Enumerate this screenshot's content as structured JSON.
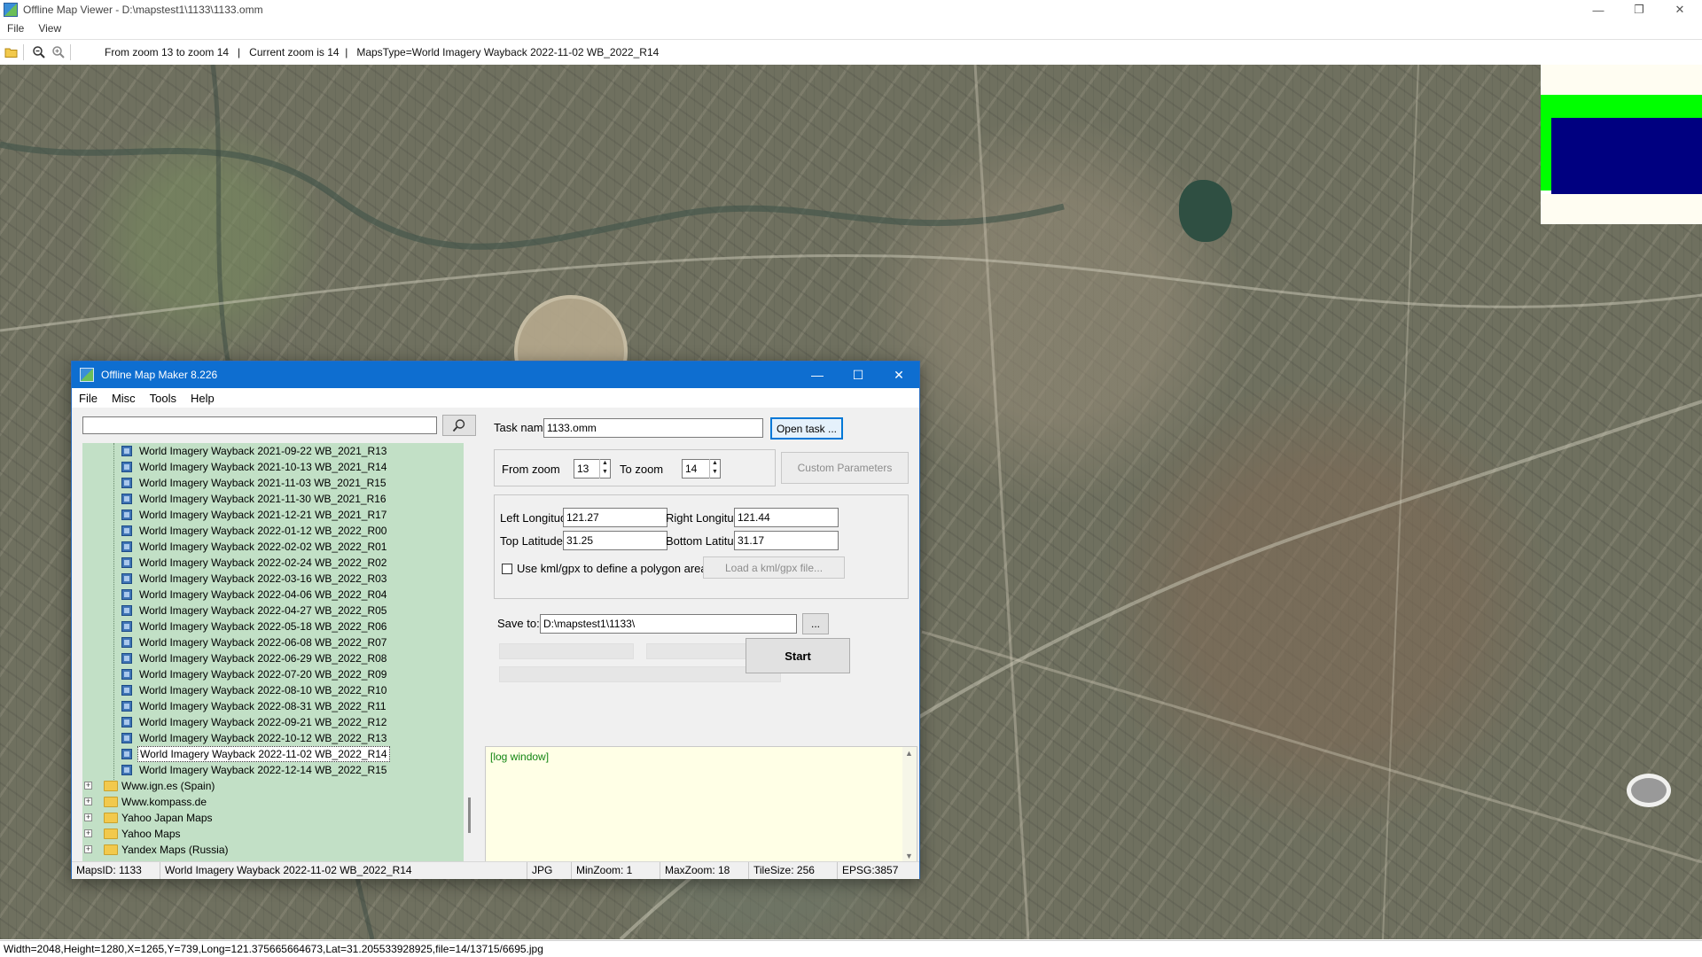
{
  "window": {
    "title": "Offline Map Viewer - D:\\mapstest1\\1133\\1133.omm",
    "menu": [
      "File",
      "View"
    ]
  },
  "toolbar": {
    "info": "From zoom 13 to zoom 14   |   Current zoom is 14  |   MapsType=World Imagery Wayback 2022-11-02 WB_2022_R14"
  },
  "status_bar": "Width=2048,Height=1280,X=1265,Y=739,Long=121.375665664673,Lat=31.205533928925,file=14/13715/6695.jpg",
  "dialog": {
    "title": "Offline Map Maker 8.226",
    "menu": [
      "File",
      "Misc",
      "Tools",
      "Help"
    ],
    "search_value": "",
    "tree_items": [
      "World Imagery Wayback 2021-09-22 WB_2021_R13",
      "World Imagery Wayback 2021-10-13 WB_2021_R14",
      "World Imagery Wayback 2021-11-03 WB_2021_R15",
      "World Imagery Wayback 2021-11-30 WB_2021_R16",
      "World Imagery Wayback 2021-12-21 WB_2021_R17",
      "World Imagery Wayback 2022-01-12 WB_2022_R00",
      "World Imagery Wayback 2022-02-02 WB_2022_R01",
      "World Imagery Wayback 2022-02-24 WB_2022_R02",
      "World Imagery Wayback 2022-03-16 WB_2022_R03",
      "World Imagery Wayback 2022-04-06 WB_2022_R04",
      "World Imagery Wayback 2022-04-27 WB_2022_R05",
      "World Imagery Wayback 2022-05-18 WB_2022_R06",
      "World Imagery Wayback 2022-06-08 WB_2022_R07",
      "World Imagery Wayback 2022-06-29 WB_2022_R08",
      "World Imagery Wayback 2022-07-20 WB_2022_R09",
      "World Imagery Wayback 2022-08-10 WB_2022_R10",
      "World Imagery Wayback 2022-08-31 WB_2022_R11",
      "World Imagery Wayback 2022-09-21 WB_2022_R12",
      "World Imagery Wayback 2022-10-12 WB_2022_R13",
      "World Imagery Wayback 2022-11-02 WB_2022_R14",
      "World Imagery Wayback 2022-12-14 WB_2022_R15"
    ],
    "selected_item": "World Imagery Wayback 2022-11-02 WB_2022_R14",
    "tree_folders": [
      "Www.ign.es (Spain)",
      "Www.kompass.de",
      "Yahoo Japan Maps",
      "Yahoo Maps",
      "Yandex Maps (Russia)"
    ],
    "task_name_label": "Task name",
    "task_name_value": "1133.omm",
    "open_task_label": "Open task ...",
    "from_zoom_label": "From zoom",
    "from_zoom_value": "13",
    "to_zoom_label": "To zoom",
    "to_zoom_value": "14",
    "custom_params_label": "Custom Parameters",
    "left_lon_label": "Left Longitude",
    "left_lon_value": "121.27",
    "right_lon_label": "Right Longitude",
    "right_lon_value": "121.44",
    "top_lat_label": "Top Latitude",
    "top_lat_value": "31.25",
    "bottom_lat_label": "Bottom Latitude",
    "bottom_lat_value": "31.17",
    "kml_checkbox_label": "Use kml/gpx to define a polygon area",
    "kml_checkbox_checked": false,
    "load_kml_label": "Load a kml/gpx file...",
    "save_to_label": "Save to:",
    "save_to_value": "D:\\mapstest1\\1133\\",
    "browse_label": "...",
    "start_label": "Start",
    "log_text": "[log window]",
    "status": {
      "maps_id": "MapsID: 1133",
      "map_name": "World Imagery Wayback 2022-11-02 WB_2022_R14",
      "format": "JPG",
      "min_zoom": "MinZoom: 1",
      "max_zoom": "MaxZoom: 18",
      "tile_size": "TileSize: 256",
      "epsg": "EPSG:3857"
    }
  },
  "colors": {
    "dialog_title_bg": "#0e6ed0",
    "tree_bg": "#c2e0c6",
    "log_bg": "#ffffe6",
    "log_text": "#128512",
    "minimap_green": "#00ff00",
    "minimap_blue": "#000080"
  }
}
